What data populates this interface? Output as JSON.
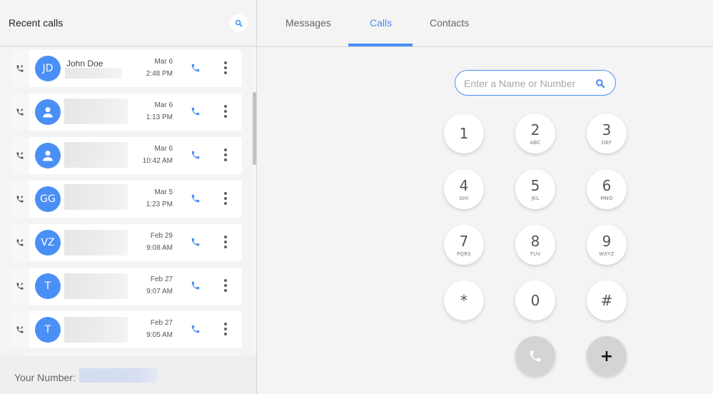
{
  "left_panel": {
    "title": "Recent calls",
    "search_icon": "search-icon",
    "calls": [
      {
        "initials": "JD",
        "name": "John Doe",
        "date": "Mar 6",
        "time": "2:48 PM",
        "avatar_type": "initials",
        "direction_icon": "outgoing-call-icon"
      },
      {
        "initials": "",
        "name": "",
        "date": "Mar 6",
        "time": "1:13 PM",
        "avatar_type": "person",
        "direction_icon": "outgoing-call-icon"
      },
      {
        "initials": "",
        "name": "",
        "date": "Mar 6",
        "time": "10:42 AM",
        "avatar_type": "person",
        "direction_icon": "outgoing-call-icon"
      },
      {
        "initials": "GG",
        "name": "",
        "date": "Mar 5",
        "time": "1:23 PM",
        "avatar_type": "initials",
        "direction_icon": "outgoing-call-icon"
      },
      {
        "initials": "VZ",
        "name": "",
        "date": "Feb 29",
        "time": "9:08 AM",
        "avatar_type": "initials",
        "direction_icon": "outgoing-call-icon"
      },
      {
        "initials": "T",
        "name": "",
        "date": "Feb 27",
        "time": "9:07 AM",
        "avatar_type": "initials",
        "direction_icon": "outgoing-call-icon"
      },
      {
        "initials": "T",
        "name": "",
        "date": "Feb 27",
        "time": "9:05 AM",
        "avatar_type": "initials",
        "direction_icon": "outgoing-call-icon"
      }
    ],
    "footer": {
      "your_number_label": "Your Number:"
    }
  },
  "tabs": [
    {
      "label": "Messages",
      "active": false
    },
    {
      "label": "Calls",
      "active": true
    },
    {
      "label": "Contacts",
      "active": false
    }
  ],
  "dialer": {
    "search_placeholder": "Enter a Name or Number",
    "search_value": "",
    "keys": [
      {
        "digit": "1",
        "letters": ""
      },
      {
        "digit": "2",
        "letters": "ABC"
      },
      {
        "digit": "3",
        "letters": "DEF"
      },
      {
        "digit": "4",
        "letters": "GHI"
      },
      {
        "digit": "5",
        "letters": "JKL"
      },
      {
        "digit": "6",
        "letters": "MNO"
      },
      {
        "digit": "7",
        "letters": "PQRS"
      },
      {
        "digit": "8",
        "letters": "TUV"
      },
      {
        "digit": "9",
        "letters": "WXYZ"
      },
      {
        "digit": "*",
        "letters": ""
      },
      {
        "digit": "0",
        "letters": ""
      },
      {
        "digit": "#",
        "letters": ""
      }
    ],
    "call_button_icon": "phone-icon",
    "add_button_label": "+"
  },
  "colors": {
    "accent": "#4a8ff5",
    "avatar_bg": "#4a8ff5",
    "background": "#f4f4f4",
    "action_button_bg": "#d4d4d4"
  }
}
